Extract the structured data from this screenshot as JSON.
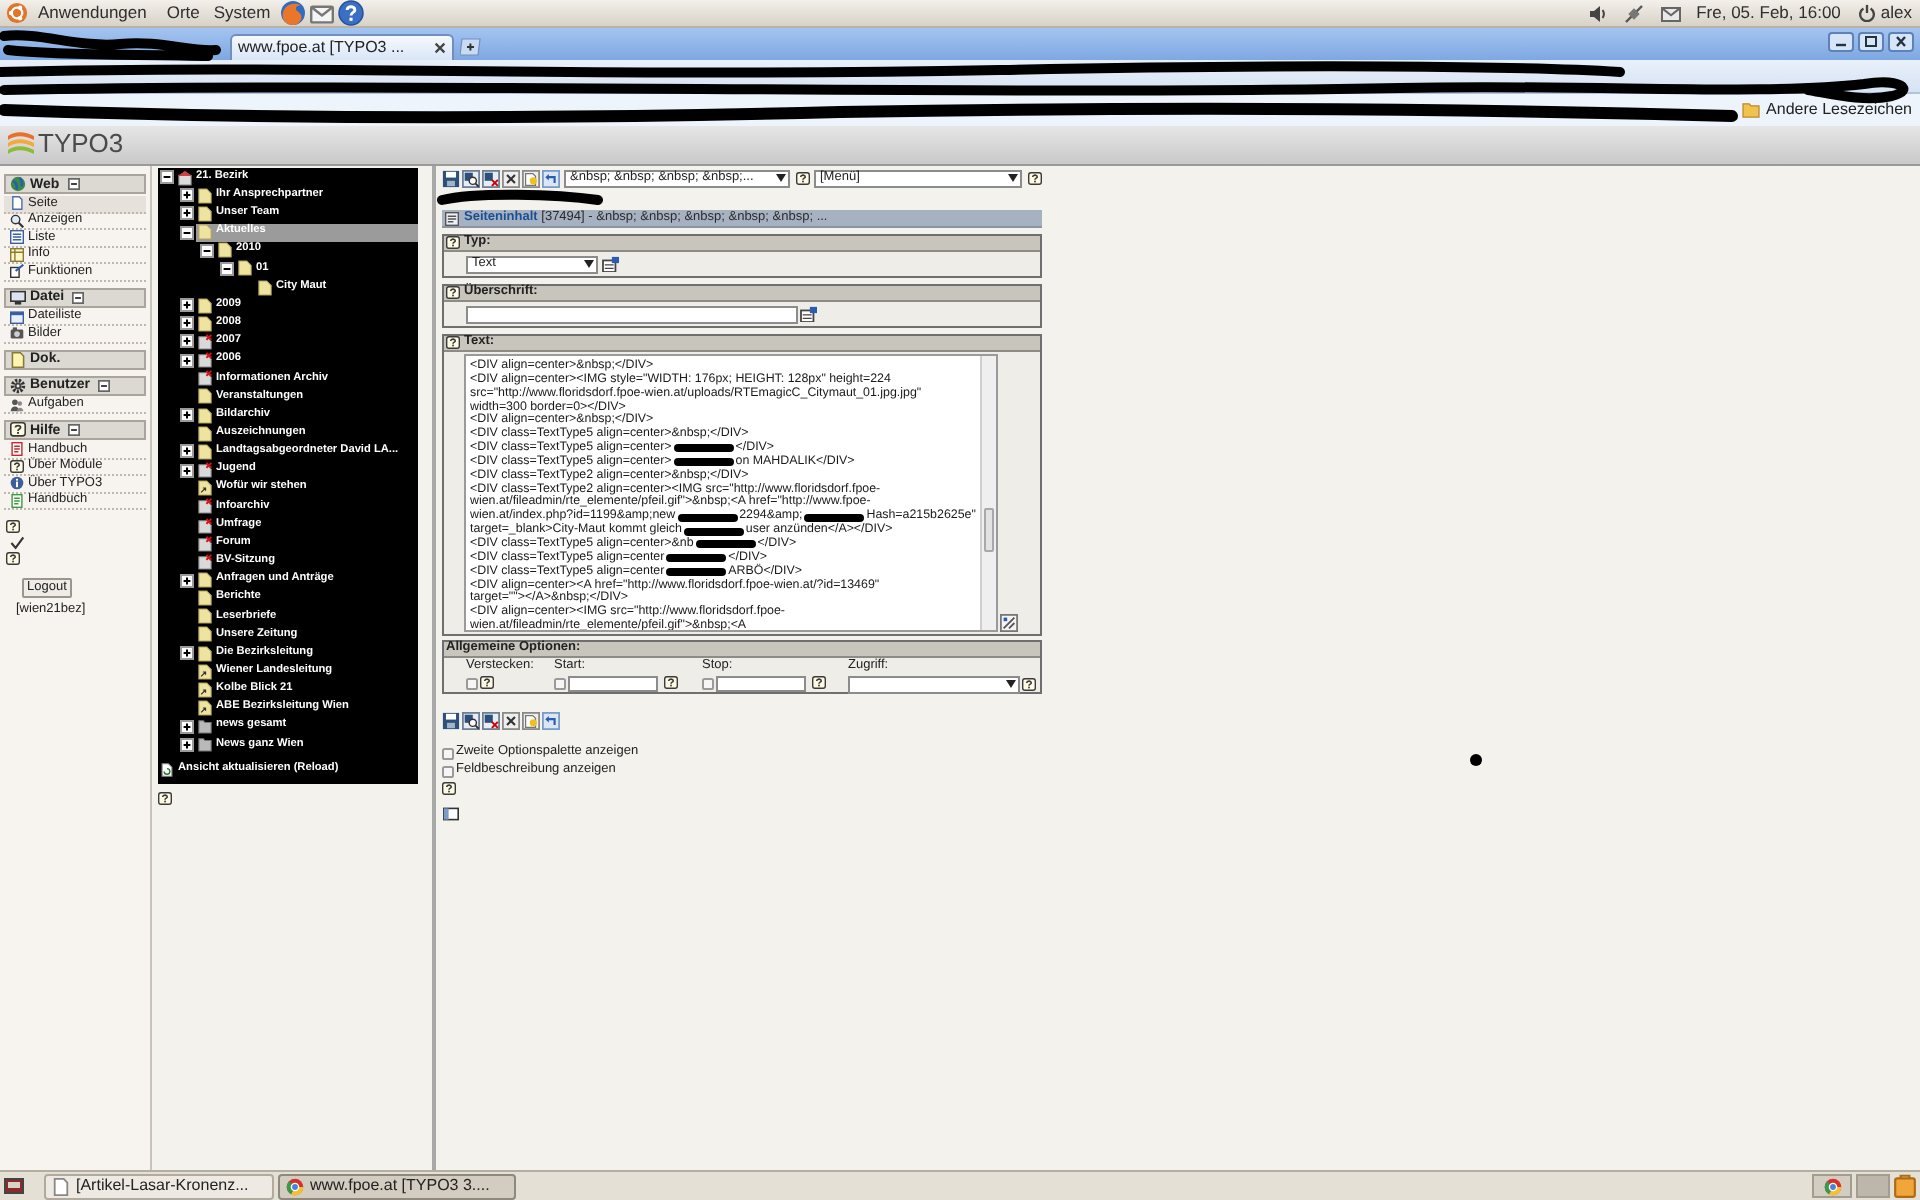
{
  "desktop_panel": {
    "menus": [
      {
        "label": "Anwendungen"
      },
      {
        "label": "Orte"
      },
      {
        "label": "System"
      }
    ],
    "clock": "Fre, 05. Feb, 16:00",
    "user": "alex"
  },
  "browser": {
    "tab_title": "www.fpoe.at [TYPO3 ...",
    "bookmarks": [
      "Andere Lesezeichen"
    ]
  },
  "typo3_header": {
    "logo": "TYPO3"
  },
  "module_menu": {
    "entries": [
      {
        "kind": "group",
        "label": "Web",
        "expanded": true,
        "items": [
          {
            "label": "Seite",
            "selected": true
          },
          {
            "label": "Anzeigen",
            "selected": false
          },
          {
            "label": "Liste",
            "selected": false
          },
          {
            "label": "Info",
            "selected": false
          },
          {
            "label": "Funktionen",
            "selected": false
          }
        ]
      },
      {
        "kind": "group",
        "label": "Datei",
        "expanded": true,
        "items": [
          {
            "label": "Dateiliste",
            "selected": false
          },
          {
            "label": "Bilder",
            "selected": false
          }
        ]
      },
      {
        "kind": "module",
        "label": "Dok.",
        "selected": false
      },
      {
        "kind": "group",
        "label": "Benutzer",
        "expanded": true,
        "items": [
          {
            "label": "Aufgaben",
            "selected": false
          }
        ]
      },
      {
        "kind": "group",
        "label": "Hilfe",
        "expanded": true,
        "items": [
          {
            "label": "Handbuch",
            "selected": false
          },
          {
            "label": "Über Module",
            "selected": false
          },
          {
            "label": "Über TYPO3",
            "selected": false
          },
          {
            "label": "Handbuch",
            "selected": false
          }
        ]
      }
    ],
    "logout": "Logout",
    "username": "[wien21bez]"
  },
  "page_tree": {
    "items": [
      {
        "label": "21. Bezirk",
        "kind": "root",
        "expanded": true,
        "selected": false,
        "children": [
          {
            "label": "Ihr Ansprechpartner",
            "kind": "page",
            "expanded": false,
            "selected": false
          },
          {
            "label": "Unser Team",
            "kind": "page",
            "expanded": false,
            "selected": false
          },
          {
            "label": "Aktuelles",
            "kind": "page",
            "expanded": true,
            "selected": true,
            "children": [
              {
                "label": "2010",
                "kind": "page",
                "expanded": true,
                "selected": false,
                "children": [
                  {
                    "label": "01",
                    "kind": "page",
                    "expanded": true,
                    "selected": false,
                    "children": [
                      {
                        "label": "City Maut",
                        "kind": "page",
                        "selected": false
                      }
                    ]
                  }
                ]
              }
            ]
          },
          {
            "label": "2009",
            "kind": "page",
            "expanded": false,
            "selected": false
          },
          {
            "label": "2008",
            "kind": "page",
            "expanded": false,
            "selected": false
          },
          {
            "label": "2007",
            "kind": "hidden",
            "expanded": false,
            "selected": false
          },
          {
            "label": "2006",
            "kind": "hidden",
            "expanded": false,
            "selected": false
          },
          {
            "label": "Informationen Archiv",
            "kind": "hidden",
            "selected": false
          },
          {
            "label": "Veranstaltungen",
            "kind": "page",
            "selected": false
          },
          {
            "label": "Bildarchiv",
            "kind": "page",
            "expanded": false,
            "selected": false
          },
          {
            "label": "Auszeichnungen",
            "kind": "page",
            "selected": false
          },
          {
            "label": "Landtagsabgeordneter David LA...",
            "kind": "page",
            "expanded": false,
            "selected": false
          },
          {
            "label": "Jugend",
            "kind": "hidden",
            "expanded": false,
            "selected": false
          },
          {
            "label": "Wofür wir stehen",
            "kind": "shortcut",
            "selected": false
          },
          {
            "label": "Infoarchiv",
            "kind": "hidden",
            "selected": false
          },
          {
            "label": "Umfrage",
            "kind": "hidden",
            "selected": false
          },
          {
            "label": "Forum",
            "kind": "hidden",
            "selected": false
          },
          {
            "label": "BV-Sitzung",
            "kind": "hidden",
            "selected": false
          },
          {
            "label": "Anfragen und Anträge",
            "kind": "page",
            "expanded": false,
            "selected": false
          },
          {
            "label": "Berichte",
            "kind": "page",
            "selected": false
          },
          {
            "label": "Leserbriefe",
            "kind": "page",
            "selected": false
          },
          {
            "label": "Unsere Zeitung",
            "kind": "page",
            "selected": false
          },
          {
            "label": "Die Bezirksleitung",
            "kind": "page",
            "expanded": false,
            "selected": false
          },
          {
            "label": "Wiener Landesleitung",
            "kind": "shortcut",
            "selected": false
          },
          {
            "label": "Kolbe Blick 21",
            "kind": "shortcut",
            "selected": false
          },
          {
            "label": "ABE Bezirksleitung Wien",
            "kind": "shortcut",
            "selected": false
          },
          {
            "label": "news gesamt",
            "kind": "sysfolder",
            "expanded": false,
            "selected": false
          },
          {
            "label": "News ganz Wien",
            "kind": "sysfolder",
            "expanded": false,
            "selected": false
          }
        ]
      }
    ],
    "reload": "Ansicht aktualisieren (Reload)"
  },
  "editor": {
    "toolbar": {
      "page_select": "&nbsp; &nbsp; &nbsp; &nbsp;...",
      "column_select": "[Menü]"
    },
    "record_header": "**Seiteninhalt** [37494] - &nbsp; &nbsp; &nbsp; &nbsp; &nbsp; ...",
    "type_section": {
      "label": "Typ:",
      "value": "Text"
    },
    "header_section": {
      "label": "Überschrift:"
    },
    "text_section": {
      "label": "Text:",
      "lines": [
        {
          "parts": [
            "<DIV align=center>&nbsp;</DIV>"
          ]
        },
        {
          "parts": [
            "<DIV align=center><IMG style=\"WIDTH: 176px; HEIGHT: 128px\" height=224"
          ]
        },
        {
          "parts": [
            "src=\"http://www.floridsdorf.fpoe-wien.at/uploads/RTEmagicC_Citymaut_01.jpg.jpg\""
          ]
        },
        {
          "parts": [
            "width=300 border=0></DIV>"
          ]
        },
        {
          "parts": [
            "<DIV align=center>&nbsp;</DIV>"
          ]
        },
        {
          "parts": [
            "<DIV class=TextType5 align=center>&nbsp;</DIV>"
          ]
        },
        {
          "parts": [
            "<DIV class=TextType5 align=center>",
            "</DIV>"
          ]
        },
        {
          "parts": [
            "<DIV class=TextType5 align=center>",
            "on MAHDALIK</DIV>"
          ]
        },
        {
          "parts": [
            "<DIV class=TextType2 align=center>&nbsp;</DIV>"
          ]
        },
        {
          "parts": [
            "<DIV class=TextType2 align=center><IMG src=\"http://www.floridsdorf.fpoe-"
          ]
        },
        {
          "parts": [
            "wien.at/fileadmin/rte_elemente/pfeil.gif\">&nbsp;<A href=\"http://www.fpoe-"
          ]
        },
        {
          "parts": [
            "wien.at/index.php?id=1199&amp;new",
            "2294&amp;",
            "Hash=a215b2625e\""
          ]
        },
        {
          "parts": [
            "target=_blank>City-Maut kommt gleich",
            "user anzünden</A></DIV>"
          ]
        },
        {
          "parts": [
            "<DIV class=TextType5 align=center>&nb",
            "</DIV>"
          ]
        },
        {
          "parts": [
            "<DIV class=TextType5 align=center",
            "</DIV>"
          ]
        },
        {
          "parts": [
            "<DIV class=TextType5 align=center",
            "ARBÖ</DIV>"
          ]
        },
        {
          "parts": [
            "<DIV align=center><A href=\"http://www.floridsdorf.fpoe-wien.at/?id=13469\""
          ]
        },
        {
          "parts": [
            "target=\"\"></A>&nbsp;</DIV>"
          ]
        },
        {
          "parts": [
            "<DIV align=center><IMG src=\"http://www.floridsdorf.fpoe-"
          ]
        },
        {
          "parts": [
            "wien.at/fileadmin/rte_elemente/pfeil.gif\">&nbsp;<A"
          ]
        }
      ]
    },
    "general_options": {
      "title": "Allgemeine Optionen:",
      "fields": [
        {
          "kind": "checkbox",
          "label": "Verstecken:",
          "checked": false
        },
        {
          "kind": "date",
          "label": "Start:",
          "checked": false
        },
        {
          "kind": "date",
          "label": "Stop:",
          "checked": false
        },
        {
          "kind": "select",
          "label": "Zugriff:"
        }
      ]
    },
    "options": [
      {
        "label": "Zweite Optionspalette anzeigen",
        "checked": false
      },
      {
        "label": "Feldbeschreibung anzeigen",
        "checked": false
      }
    ]
  },
  "taskbar": {
    "windows": [
      {
        "title": "[Artikel-Lasar-Kronenz...",
        "selected": false
      },
      {
        "title": "www.fpoe.at [TYPO3 3....",
        "selected": true
      }
    ]
  }
}
